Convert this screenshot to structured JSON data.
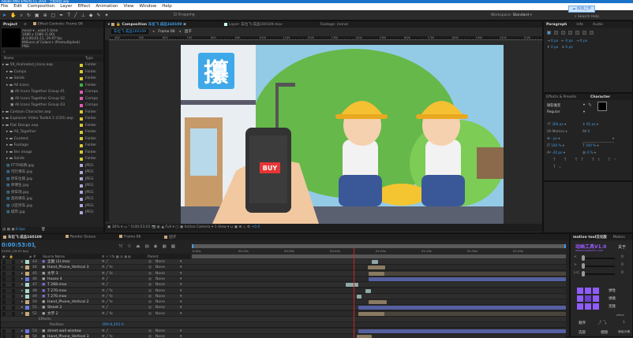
{
  "window": {
    "title": "Adobe After Effects CC 2014 - 工程项目.aep"
  },
  "menu": [
    "File",
    "Edit",
    "Composition",
    "Layer",
    "Effect",
    "Animation",
    "View",
    "Window",
    "Help"
  ],
  "toolbar": {
    "snapping": "Snapping",
    "workspace_label": "Workspace:",
    "workspace_value": "Standard",
    "search_help": "Search Help",
    "upload_button": "拖拽上传"
  },
  "project": {
    "tab": "Project",
    "effect_controls_tab": "Effect Controls: Frame 06",
    "info": [
      "move ▾ , used 1 time",
      "1080 x 1080 (1.00)",
      "Δ 0;00;01;11, 29.97 fps",
      "Millions of Colors+ (Premultiplied)",
      "PNG"
    ],
    "columns": {
      "name": "Name",
      "type": "Type"
    },
    "items": [
      {
        "name": "59_Animated_Icons.aep",
        "type": "Folder",
        "color": "#d8c832",
        "indent": 0,
        "kind": "folder"
      },
      {
        "name": "Comps",
        "type": "Folder",
        "color": "#d8c832",
        "indent": 1,
        "kind": "folder"
      },
      {
        "name": "Solids",
        "type": "Folder",
        "color": "#d8c832",
        "indent": 1,
        "kind": "folder"
      },
      {
        "name": "All Icons",
        "type": "Folder",
        "color": "#3cb043",
        "indent": 1,
        "kind": "folder"
      },
      {
        "name": "All Icons Together Group 01",
        "type": "Compo",
        "color": "#e05ab8",
        "indent": 2,
        "kind": "comp"
      },
      {
        "name": "All Icons Together Group 02",
        "type": "Compo",
        "color": "#e05ab8",
        "indent": 2,
        "kind": "comp"
      },
      {
        "name": "All Icons Together Group 03",
        "type": "Compo",
        "color": "#e05ab8",
        "indent": 2,
        "kind": "comp"
      },
      {
        "name": "Cartoon Character.aep",
        "type": "Folder",
        "color": "#d8c832",
        "indent": 0,
        "kind": "folder"
      },
      {
        "name": "Explainer Video Toolkit 2 (CS5).aep",
        "type": "Folder",
        "color": "#d8c832",
        "indent": 0,
        "kind": "folder"
      },
      {
        "name": "Flat Design.aep",
        "type": "Folder",
        "color": "#d8c832",
        "indent": 0,
        "kind": "folder"
      },
      {
        "name": "All_Together",
        "type": "Folder",
        "color": "#d8c832",
        "indent": 1,
        "kind": "folder"
      },
      {
        "name": "Content",
        "type": "Folder",
        "color": "#d8c832",
        "indent": 1,
        "kind": "folder"
      },
      {
        "name": "Footage",
        "type": "Folder",
        "color": "#d8c832",
        "indent": 1,
        "kind": "folder"
      },
      {
        "name": "the image",
        "type": "Folder",
        "color": "#d8c832",
        "indent": 1,
        "kind": "folder"
      },
      {
        "name": "Solids",
        "type": "Folder",
        "color": "#d8c832",
        "indent": 1,
        "kind": "folder"
      },
      {
        "name": "FTTR标牌.jpg",
        "type": "JPEG",
        "color": "#b0a8d8",
        "indent": 1,
        "kind": "image"
      },
      {
        "name": "可行课车.jpg",
        "type": "JPEG",
        "color": "#b0a8d8",
        "indent": 1,
        "kind": "image"
      },
      {
        "name": "停车位锁.jpg",
        "type": "JPEG",
        "color": "#b0a8d8",
        "indent": 1,
        "kind": "image"
      },
      {
        "name": "师傅生.jpg",
        "type": "JPEG",
        "color": "#b0a8d8",
        "indent": 1,
        "kind": "image"
      },
      {
        "name": "停车场.jpg",
        "type": "JPEG",
        "color": "#b0a8d8",
        "indent": 1,
        "kind": "image"
      },
      {
        "name": "黑商课车.jpg",
        "type": "JPEG",
        "color": "#b0a8d8",
        "indent": 1,
        "kind": "image"
      },
      {
        "name": "小区停车.jpg",
        "type": "JPEG",
        "color": "#b0a8d8",
        "indent": 1,
        "kind": "image"
      },
      {
        "name": "城市.jpg",
        "type": "JPEG",
        "color": "#b0a8d8",
        "indent": 1,
        "kind": "image"
      }
    ],
    "bpc": "8 bpc"
  },
  "composition": {
    "tab": "Composition",
    "comp_name": "车位飞 成品160109",
    "layer_tab": "Layer: 车位飞 成品160109.mov",
    "footage_tab": "Footage: (none)",
    "breadcrumbs": [
      "车位飞 成品160109",
      "Frame 06",
      "团子"
    ],
    "ruler": [
      "400",
      "500",
      "600",
      "700",
      "800",
      "900",
      "1000",
      "1100",
      "1200",
      "1300",
      "1400",
      "1500",
      "1600",
      "1700",
      "1800",
      "1900",
      "2000",
      "2100"
    ],
    "scene": {
      "sign": "攥",
      "buy_button": "BUY"
    },
    "footer": {
      "zoom": "30%",
      "timecode": "0;00;53;01",
      "resolution": "Full",
      "camera": "Active Camera",
      "views": "1 View",
      "exposure": "+0.0"
    }
  },
  "paragraph": {
    "tabs": [
      "Paragraph",
      "Info",
      "Audio"
    ],
    "fields": [
      "0 px",
      "0 px",
      "0 px",
      "0 px",
      "0 px"
    ]
  },
  "character": {
    "tabs": [
      "Effects & Presets",
      "Character"
    ],
    "font": "微软雅黑",
    "style": "Regular",
    "size": "300 px",
    "leading": "92 px",
    "kerning": "Metrics",
    "tracking": "0",
    "stroke": "- px",
    "vscale": "100 %",
    "hscale": "100 %",
    "baseline": "-20 px",
    "tsume": "0 %"
  },
  "timeline": {
    "tabs": [
      "车位飞 成品160109",
      "Render Queue",
      "Frame 06",
      "团子"
    ],
    "timecode": "0:00:53:01",
    "fps": "01591 (29.97 fps)",
    "columns": {
      "num": "#",
      "source": "Source Name",
      "parent": "Parent"
    },
    "ruler": [
      "0:00s",
      "00:15s",
      "00:30s",
      "00:45s",
      "01:00s",
      "01:15s",
      "01:30s",
      "01:45s"
    ],
    "playhead_seconds": 53.03,
    "duration_seconds": 122.6,
    "layers": [
      {
        "num": "43",
        "name": "全图 (2).mov",
        "color": "#a8d8c8",
        "kind": "mov",
        "fx": false,
        "parent": "None",
        "bar": [
          59,
          61
        ],
        "bar_color": "#8fa8a8"
      },
      {
        "num": "44",
        "name": "Hand_Phone_Vertical 3",
        "color": "#c8a878",
        "kind": "comp",
        "fx": true,
        "parent": "None",
        "bar": [
          57.8,
          63.5
        ],
        "bar_color": "#8a7a62"
      },
      {
        "num": "45",
        "name": "文字 3",
        "color": "#c8a878",
        "kind": "comp",
        "fx": true,
        "parent": "None",
        "bar": [
          58,
          63
        ],
        "bar_color": "#8a7a62",
        "tail": true
      },
      {
        "num": "46",
        "name": "Hoose 4",
        "color": "#6a78e0",
        "kind": "comp",
        "fx": false,
        "parent": "None",
        "bar": [
          58,
          122.6
        ],
        "bar_color": "#5560a0"
      },
      {
        "num": "47",
        "name": "T 268.mov",
        "color": "#a8d8c8",
        "kind": "mov",
        "fx": false,
        "parent": "None",
        "bar": [
          50.5,
          54.5
        ],
        "bar_color": "#8fa8a8"
      },
      {
        "num": "48",
        "name": "T 270.mov",
        "color": "#a8d8c8",
        "kind": "mov",
        "fx": true,
        "parent": "None",
        "bar": [
          57,
          58.6
        ],
        "bar_color": "#8fa8a8"
      },
      {
        "num": "49",
        "name": "T 270.mov",
        "color": "#a8d8c8",
        "kind": "mov",
        "fx": true,
        "parent": "None",
        "bar": [
          54,
          55.5
        ],
        "bar_color": "#8fa8a8"
      },
      {
        "num": "50",
        "name": "Hand_Phone_Vertical 2",
        "color": "#c8a878",
        "kind": "comp",
        "fx": true,
        "parent": "None",
        "bar": [
          58,
          64
        ],
        "bar_color": "#8a7a62"
      },
      {
        "num": "51",
        "name": "Street 2",
        "color": "#6a78e0",
        "kind": "comp",
        "fx": false,
        "parent": "None",
        "bar": [
          54.5,
          122.6
        ],
        "bar_color": "#5560a0"
      },
      {
        "num": "52",
        "name": "文字 2",
        "color": "#c8a878",
        "kind": "comp",
        "fx": true,
        "parent": "None",
        "bar": [
          54.5,
          63
        ],
        "bar_color": "#8a7a62",
        "tail": true,
        "expanded": true
      },
      {
        "sub": "Effects"
      },
      {
        "sub": "Position",
        "value": "399.8,202.0"
      },
      {
        "num": "53",
        "name": "street wall window",
        "color": "#6a78e0",
        "kind": "comp",
        "fx": false,
        "parent": "None",
        "bar": [
          54.5,
          122.6
        ],
        "bar_color": "#5560a0"
      },
      {
        "num": "54",
        "name": "Hand_Phone_Vertical 3",
        "color": "#c8a878",
        "kind": "comp",
        "fx": true,
        "parent": "None",
        "bar": [
          54,
          59
        ],
        "bar_color": "#8a7a62"
      }
    ]
  },
  "motion_tool": {
    "tab": "motion tool汉化版",
    "tab2": "Motion",
    "logo": "动画工具V1.0",
    "url": "www.xxgraphic.com",
    "tool_label": "关于",
    "sliders": [
      {
        "label": "<",
        "value": "0"
      },
      {
        "label": ">",
        "value": "0"
      },
      {
        "label": "|<|",
        "value": "0"
      }
    ],
    "buttons": [
      "弹性",
      "弹跳",
      "克隆",
      "顺序",
      "选取",
      "相随"
    ],
    "offset": "offset",
    "offset_value": "1",
    "extra": "添加/分离"
  }
}
